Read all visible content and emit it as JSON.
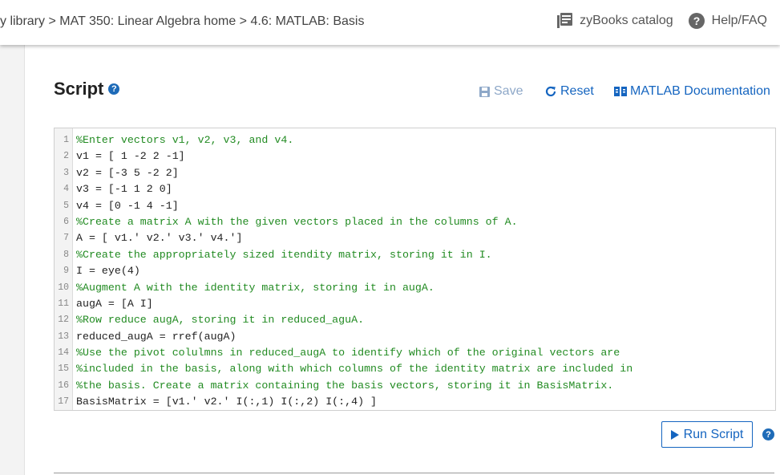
{
  "breadcrumb": {
    "items": [
      "y library",
      "MAT 350: Linear Algebra home",
      "4.6: MATLAB: Basis"
    ],
    "separator": " > "
  },
  "topnav": {
    "catalog_label": "zyBooks catalog",
    "help_label": "Help/FAQ"
  },
  "script": {
    "title": "Script",
    "help_glyph": "?",
    "save_label": "Save",
    "reset_label": "Reset",
    "docs_label": "MATLAB Documentation",
    "run_label": "Run Script"
  },
  "editor": {
    "lines": [
      {
        "n": "1",
        "text": "%Enter vectors v1, v2, v3, and v4.",
        "comment": true
      },
      {
        "n": "2",
        "text": "v1 = [ 1 -2 2 -1]",
        "comment": false
      },
      {
        "n": "3",
        "text": "v2 = [-3 5 -2 2]",
        "comment": false
      },
      {
        "n": "4",
        "text": "v3 = [-1 1 2 0]",
        "comment": false
      },
      {
        "n": "5",
        "text": "v4 = [0 -1 4 -1]",
        "comment": false
      },
      {
        "n": "6",
        "text": "%Create a matrix A with the given vectors placed in the columns of A.",
        "comment": true
      },
      {
        "n": "7",
        "text": "A = [ v1.' v2.' v3.' v4.']",
        "comment": false
      },
      {
        "n": "8",
        "text": "%Create the appropriately sized itendity matrix, storing it in I.",
        "comment": true
      },
      {
        "n": "9",
        "text": "I = eye(4)",
        "comment": false
      },
      {
        "n": "10",
        "text": "%Augment A with the identity matrix, storing it in augA.",
        "comment": true
      },
      {
        "n": "11",
        "text": "augA = [A I]",
        "comment": false
      },
      {
        "n": "12",
        "text": "%Row reduce augA, storing it in reduced_aguA.",
        "comment": true
      },
      {
        "n": "13",
        "text": "reduced_augA = rref(augA)",
        "comment": false
      },
      {
        "n": "14",
        "text": "%Use the pivot colulmns in reduced_augA to identify which of the original vectors are",
        "comment": true
      },
      {
        "n": "15",
        "text": "%included in the basis, along with which columns of the identity matrix are included in",
        "comment": true
      },
      {
        "n": "16",
        "text": "%the basis. Create a matrix containing the basis vectors, storing it in BasisMatrix.",
        "comment": true
      },
      {
        "n": "17",
        "text": "BasisMatrix = [v1.' v2.' I(:,1) I(:,2) I(:,4) ]",
        "comment": false
      }
    ]
  },
  "colors": {
    "accent": "#1565c0",
    "comment": "#228b22",
    "save_disabled": "#8ea8c8"
  }
}
